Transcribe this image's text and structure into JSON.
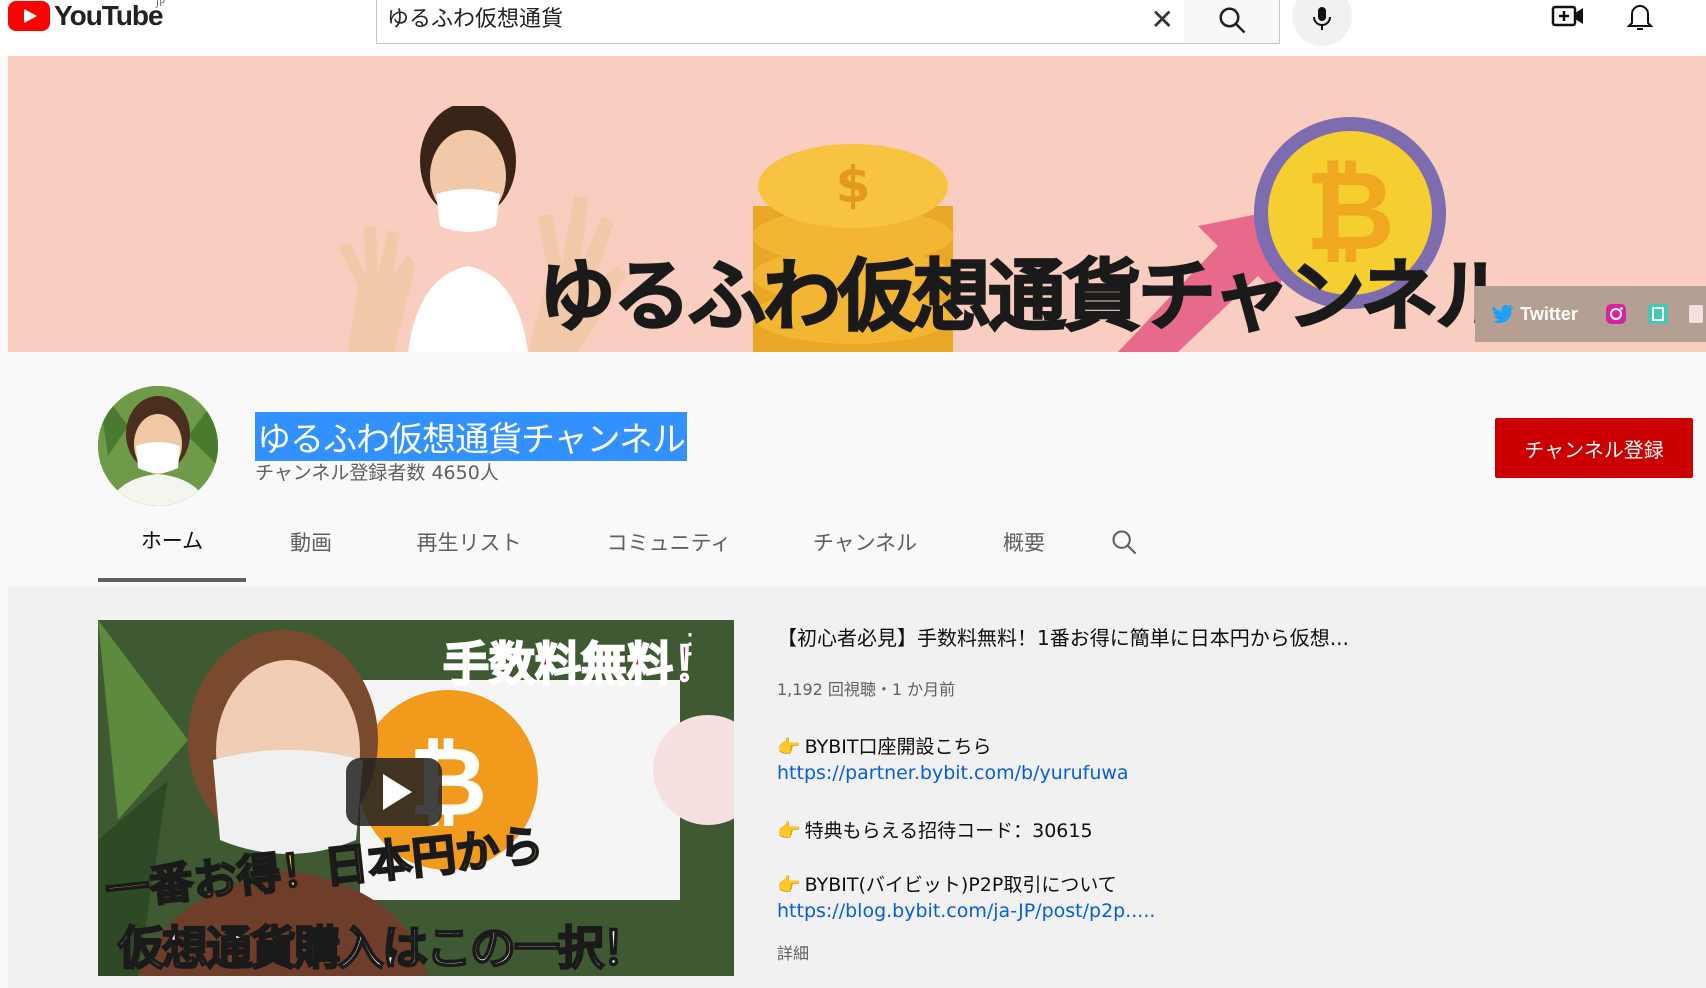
{
  "header": {
    "logo_text": "YouTube",
    "country": "JP",
    "search_value": "ゆるふわ仮想通貨",
    "icons": [
      "search-icon",
      "mic-icon",
      "create-video-icon",
      "notifications-icon"
    ]
  },
  "banner": {
    "title": "ゆるふわ仮想通貨チャンネル",
    "twitter_label": "Twitter"
  },
  "channel": {
    "name": "ゆるふわ仮想通貨チャンネル",
    "subscribers": "チャンネル登録者数 4650人",
    "subscribe_label": "チャンネル登録"
  },
  "tabs": [
    {
      "label": "ホーム",
      "active": true
    },
    {
      "label": "動画"
    },
    {
      "label": "再生リスト"
    },
    {
      "label": "コミュニティ"
    },
    {
      "label": "チャンネル"
    },
    {
      "label": "概要"
    }
  ],
  "featured_video": {
    "title": "【初心者必見】手数料無料！1番お得に簡単に日本円から仮想...",
    "meta": "1,192 回視聴・1 か月前",
    "thumbnail_texts": {
      "top": "手数料無料！",
      "middle": "一番お得！日本円から",
      "bottom": "仮想通貨購入はこの一択！"
    },
    "description": [
      {
        "type": "text",
        "value": "BYBIT口座開設こちら"
      },
      {
        "type": "link",
        "value": "https://partner.bybit.com/b/yurufuwa"
      },
      {
        "type": "text",
        "value": "特典もらえる招待コード：30615"
      },
      {
        "type": "text",
        "value": "BYBIT(バイビット)P2P取引について"
      },
      {
        "type": "link",
        "value": "https://blog.bybit.com/ja-JP/post/p2p....."
      }
    ],
    "more_label": "詳細"
  },
  "colors": {
    "youtube_red": "#ff0000",
    "subscribe_red": "#cc0000",
    "banner_bg": "#f9cdbf",
    "link_blue": "#065fd4",
    "selection_blue": "#3390ff"
  }
}
